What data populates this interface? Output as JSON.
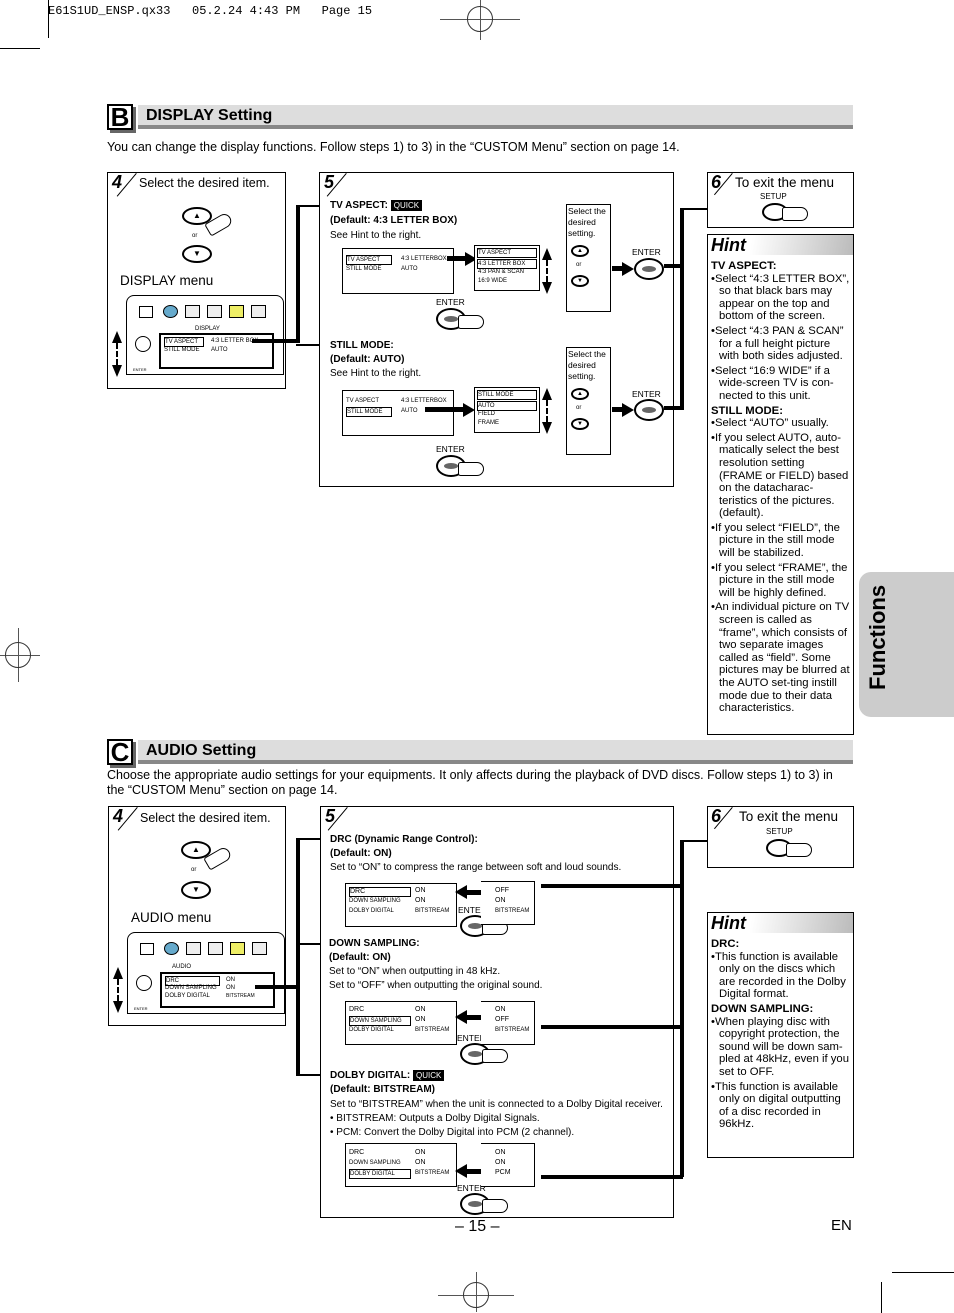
{
  "slug": "E61S1UD_ENSP.qx33   05.2.24 4:43 PM   Page 15",
  "side_tab": "Functions",
  "page_number": "– 15 –",
  "language": "EN",
  "display": {
    "letter": "B",
    "title": "DISPLAY Setting",
    "intro": "You can change the display functions. Follow steps 1) to 3) in the “CUSTOM Menu” section on page 14.",
    "step4": {
      "num": "4",
      "text": "Select the desired item.",
      "or": "or",
      "menu_label": "DISPLAY menu",
      "menu_tab": "DISPLAY",
      "enter": "ENTER",
      "rows": [
        {
          "item": "TV ASPECT",
          "value": "4:3 LETTER BOX"
        },
        {
          "item": "STILL MODE",
          "value": "AUTO"
        }
      ]
    },
    "step5": {
      "num": "5",
      "tv_aspect": {
        "title": "TV ASPECT:",
        "quick": "QUICK",
        "default": "(Default: 4:3 LETTER BOX)",
        "note": "See Hint to the right.",
        "screen_rows": [
          {
            "item": "TV ASPECT",
            "value": "4:3 LETTERBOX"
          },
          {
            "item": "STILL MODE",
            "value": "AUTO"
          }
        ],
        "options_header": "TV ASPECT",
        "options": [
          "4:3 LETTER BOX",
          "4:3 PAN & SCAN",
          "16:9 WIDE"
        ],
        "select_text": "Select the desired setting.",
        "or": "or",
        "enter": "ENTER"
      },
      "still_mode": {
        "title": "STILL MODE:",
        "default": "(Default: AUTO)",
        "note": "See Hint to the right.",
        "screen_rows": [
          {
            "item": "TV ASPECT",
            "value": "4:3 LETTERBOX"
          },
          {
            "item": "STILL MODE",
            "value": "AUTO"
          }
        ],
        "options_header": "STILL MODE",
        "options": [
          "AUTO",
          "FIELD",
          "FRAME"
        ],
        "select_text": "Select the desired setting.",
        "or": "or",
        "enter": "ENTER"
      }
    },
    "step6": {
      "num": "6",
      "text": "To exit the menu",
      "button": "SETUP"
    },
    "hint": {
      "title": "Hint",
      "sections": [
        {
          "heading": "TV ASPECT:",
          "bullets": [
            "Select “4:3 LETTER BOX”, so that black bars may appear on the top and bottom of the screen.",
            "Select “4:3 PAN & SCAN” for a full height picture with both sides adjusted.",
            "Select “16:9 WIDE” if a wide-screen TV is con-nected to this unit."
          ]
        },
        {
          "heading": "STILL MODE:",
          "bullets": [
            "Select “AUTO” usually.",
            "If you select AUTO, auto-matically select the best resolution setting (FRAME or FIELD) based on the datacharac-teristics of the pictures. (default).",
            "If you select “FIELD”, the picture in the still mode will be stabilized.",
            "If you select “FRAME”, the picture in the still mode will be highly defined.",
            "An individual picture on TV screen is called as “frame”, which consists of two separate images called as “field”. Some pictures may be blurred at the AUTO set-ting instill mode due to their data characteristics."
          ]
        }
      ]
    }
  },
  "audio": {
    "letter": "C",
    "title": "AUDIO Setting",
    "intro": "Choose the appropriate audio settings for your equipments. It only affects during the playback of DVD discs. Follow steps 1) to 3) in the “CUSTOM Menu” section on page 14.",
    "step4": {
      "num": "4",
      "text": "Select the desired item.",
      "or": "or",
      "menu_label": "AUDIO menu",
      "menu_tab": "AUDIO",
      "enter": "ENTER",
      "rows": [
        {
          "item": "DRC",
          "value": "ON"
        },
        {
          "item": "DOWN SAMPLING",
          "value": "ON"
        },
        {
          "item": "DOLBY DIGITAL",
          "value": "BITSTREAM"
        }
      ]
    },
    "step5": {
      "num": "5",
      "drc": {
        "title": "DRC (Dynamic Range Control):",
        "default": "(Default: ON)",
        "desc": [
          "Set to “ON” to compress the range between soft and loud sounds."
        ],
        "rows": [
          {
            "item": "DRC",
            "value": "ON"
          },
          {
            "item": "DOWN SAMPLING",
            "value": "ON"
          },
          {
            "item": "DOLBY DIGITAL",
            "value": "BITSTREAM"
          }
        ],
        "result": [
          "OFF",
          "ON",
          "BITSTREAM"
        ],
        "enter": "ENTER"
      },
      "down_sampling": {
        "title": "DOWN SAMPLING:",
        "default": "(Default: ON)",
        "desc": [
          "Set to “ON” when outputting in 48 kHz.",
          "Set to “OFF” when outputting the original sound."
        ],
        "rows": [
          {
            "item": "DRC",
            "value": "ON"
          },
          {
            "item": "DOWN SAMPLING",
            "value": "ON"
          },
          {
            "item": "DOLBY DIGITAL",
            "value": "BITSTREAM"
          }
        ],
        "result": [
          "ON",
          "OFF",
          "BITSTREAM"
        ],
        "enter": "ENTER"
      },
      "dolby_digital": {
        "title": "DOLBY DIGITAL:",
        "quick": "QUICK",
        "default": "(Default: BITSTREAM)",
        "desc": [
          "Set to “BITSTREAM” when the unit is connected to a Dolby Digital receiver.",
          "• BITSTREAM: Outputs a Dolby Digital Signals.",
          "• PCM: Convert the Dolby Digital into PCM (2 channel)."
        ],
        "rows": [
          {
            "item": "DRC",
            "value": "ON"
          },
          {
            "item": "DOWN SAMPLING",
            "value": "ON"
          },
          {
            "item": "DOLBY DIGITAL",
            "value": "BITSTREAM"
          }
        ],
        "result": [
          "ON",
          "ON",
          "PCM"
        ],
        "enter": "ENTER"
      }
    },
    "step6": {
      "num": "6",
      "text": "To exit the menu",
      "button": "SETUP"
    },
    "hint": {
      "title": "Hint",
      "sections": [
        {
          "heading": "DRC:",
          "bullets": [
            "This function is available only on the discs which are recorded in the Dolby Digital format."
          ]
        },
        {
          "heading": "DOWN SAMPLING:",
          "bullets": [
            "When playing disc with copyright protection, the sound will be down sam-pled at 48kHz, even if you set to OFF.",
            "This function is available only on digital outputting of a disc recorded in 96kHz."
          ]
        }
      ]
    }
  }
}
